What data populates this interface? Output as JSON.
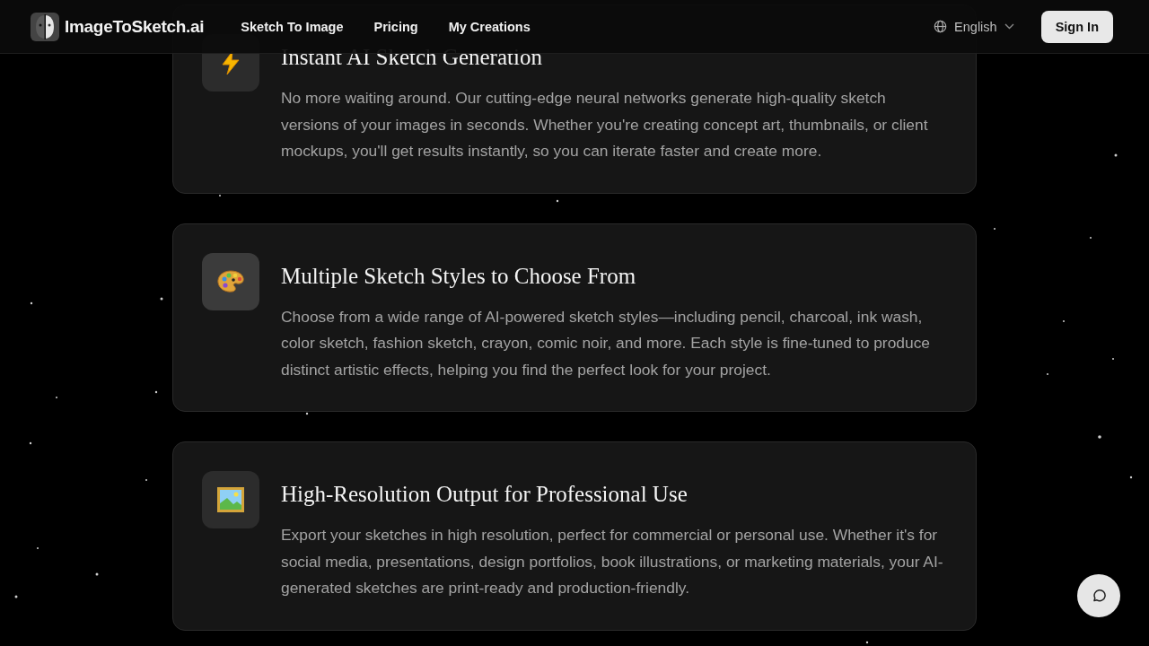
{
  "header": {
    "logo_text": "ImageToSketch.ai",
    "nav": [
      {
        "label": "Sketch To Image"
      },
      {
        "label": "Pricing"
      },
      {
        "label": "My Creations"
      }
    ],
    "language": "English",
    "sign_in": "Sign In"
  },
  "features": [
    {
      "kind": "lightning",
      "title": "Instant AI Sketch Generation",
      "text": "No more waiting around. Our cutting-edge neural networks generate high-quality sketch versions of your images in seconds. Whether you're creating concept art, thumbnails, or client mockups, you'll get results instantly, so you can iterate faster and create more."
    },
    {
      "kind": "palette",
      "title": "Multiple Sketch Styles to Choose From",
      "text": "Choose from a wide range of AI-powered sketch styles—including pencil, charcoal, ink wash, color sketch, fashion sketch, crayon, comic noir, and more. Each style is fine-tuned to produce distinct artistic effects, helping you find the perfect look for your project."
    },
    {
      "kind": "picture",
      "title": "High-Resolution Output for Professional Use",
      "text": "Export your sketches in high resolution, perfect for commercial or personal use. Whether it's for social media, presentations, design portfolios, book illustrations, or marketing materials, your AI-generated sketches are print-ready and production-friendly."
    }
  ]
}
